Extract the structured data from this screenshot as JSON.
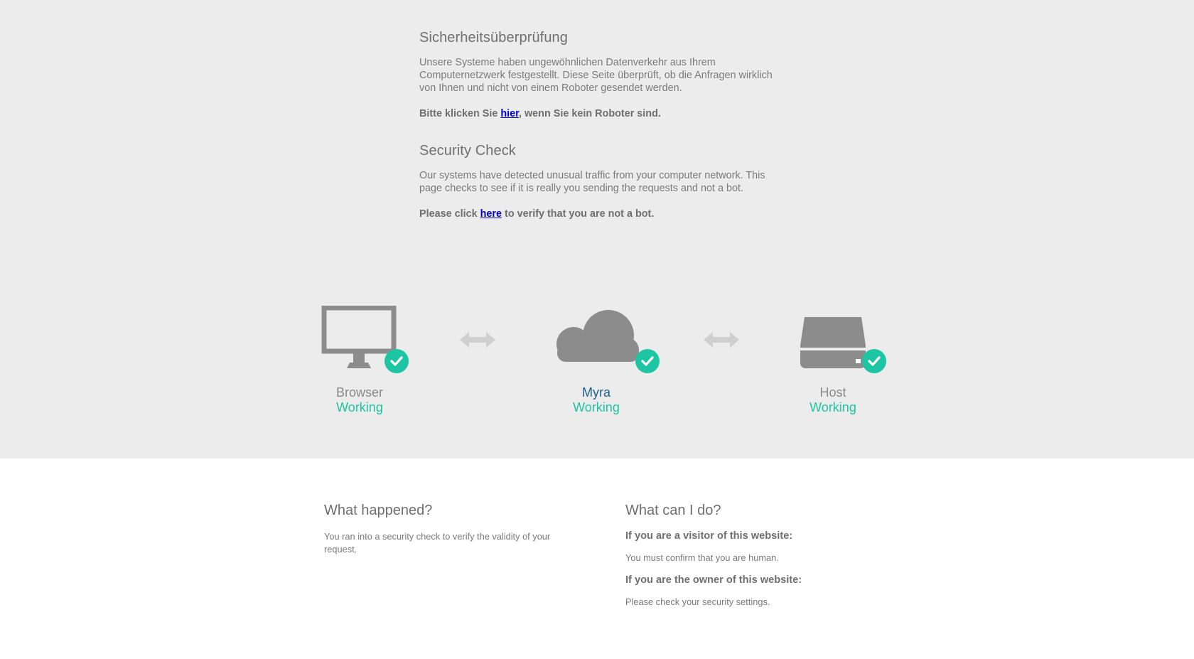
{
  "german": {
    "heading": "Sicherheitsüberprüfung",
    "body": "Unsere Systeme haben ungewöhnlichen Datenverkehr aus Ihrem Computernetzwerk festgestellt. Diese Seite überprüft, ob die Anfragen wirklich von Ihnen und nicht von einem Roboter gesendet werden.",
    "cta_before": "Bitte klicken Sie ",
    "cta_link": "hier",
    "cta_after": ", wenn Sie kein Roboter sind."
  },
  "english": {
    "heading": "Security Check",
    "body": "Our systems have detected unusual traffic from your computer network. This page checks to see if it is really you sending the requests and not a bot.",
    "cta_before": "Please click ",
    "cta_link": "here",
    "cta_after": " to verify that you are not a bot."
  },
  "status_nodes": [
    {
      "title": "Browser",
      "status": "Working",
      "icon": "monitor-icon"
    },
    {
      "title": "Myra",
      "status": "Working",
      "icon": "cloud-icon"
    },
    {
      "title": "Host",
      "status": "Working",
      "icon": "server-drive-icon"
    }
  ],
  "info": {
    "what_happened": {
      "heading": "What happened?",
      "text": "You ran into a security check to verify the validity of your request."
    },
    "what_can_i_do": {
      "heading": "What can I do?",
      "visitor_heading": "If you are a visitor of this website:",
      "visitor_text": "You must confirm that you are human.",
      "owner_heading": "If you are the owner of this website:",
      "owner_text": "Please check your security settings."
    }
  },
  "colors": {
    "top_background": "#ececec",
    "check_green": "#1ec5a5",
    "icon_gray": "#8c8c8c",
    "myra_blue": "#1f5f8e",
    "link_blue": "#0000cc"
  }
}
